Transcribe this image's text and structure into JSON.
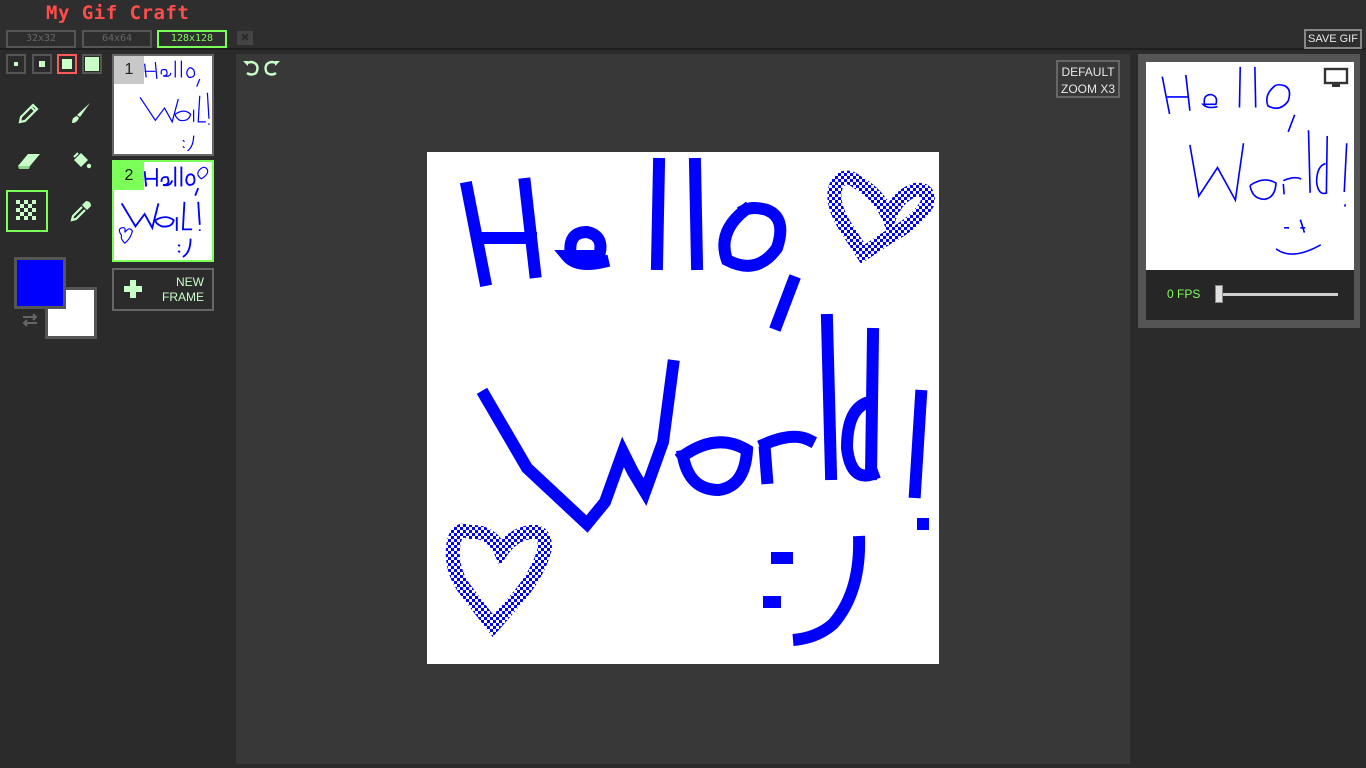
{
  "app": {
    "title": "My Gif Craft"
  },
  "sizes": [
    "32x32",
    "64x64",
    "128x128"
  ],
  "selected_size": "128x128",
  "toolbar": {
    "save_label": "SAVE GIF",
    "close_icon": "close-icon"
  },
  "brushes": [
    {
      "name": "brush-size-1",
      "active": false
    },
    {
      "name": "brush-size-2",
      "active": false
    },
    {
      "name": "brush-size-3",
      "active": true
    },
    {
      "name": "brush-size-4",
      "active": false
    }
  ],
  "tools": [
    {
      "name": "pencil-tool",
      "icon": "pencil-icon",
      "active": false
    },
    {
      "name": "brush-tool",
      "icon": "paintbrush-icon",
      "active": false
    },
    {
      "name": "eraser-tool",
      "icon": "eraser-icon",
      "active": false
    },
    {
      "name": "fill-tool",
      "icon": "paint-bucket-icon",
      "active": false
    },
    {
      "name": "dither-tool",
      "icon": "checkerboard-icon",
      "active": true
    },
    {
      "name": "eyedropper-tool",
      "icon": "eyedropper-icon",
      "active": false
    }
  ],
  "colors": {
    "primary": "#0000ff",
    "secondary": "#ffffff",
    "accent": "#7dff5a",
    "title": "#ff4d4d"
  },
  "frames": [
    {
      "number": "1",
      "active": false
    },
    {
      "number": "2",
      "active": true
    }
  ],
  "new_frame": {
    "line1": "NEW",
    "line2": "FRAME"
  },
  "zoom": {
    "line1": "DEFAULT",
    "line2": "ZOOM X3"
  },
  "preview": {
    "fps_label": "0 FPS",
    "fps_value": 0
  }
}
